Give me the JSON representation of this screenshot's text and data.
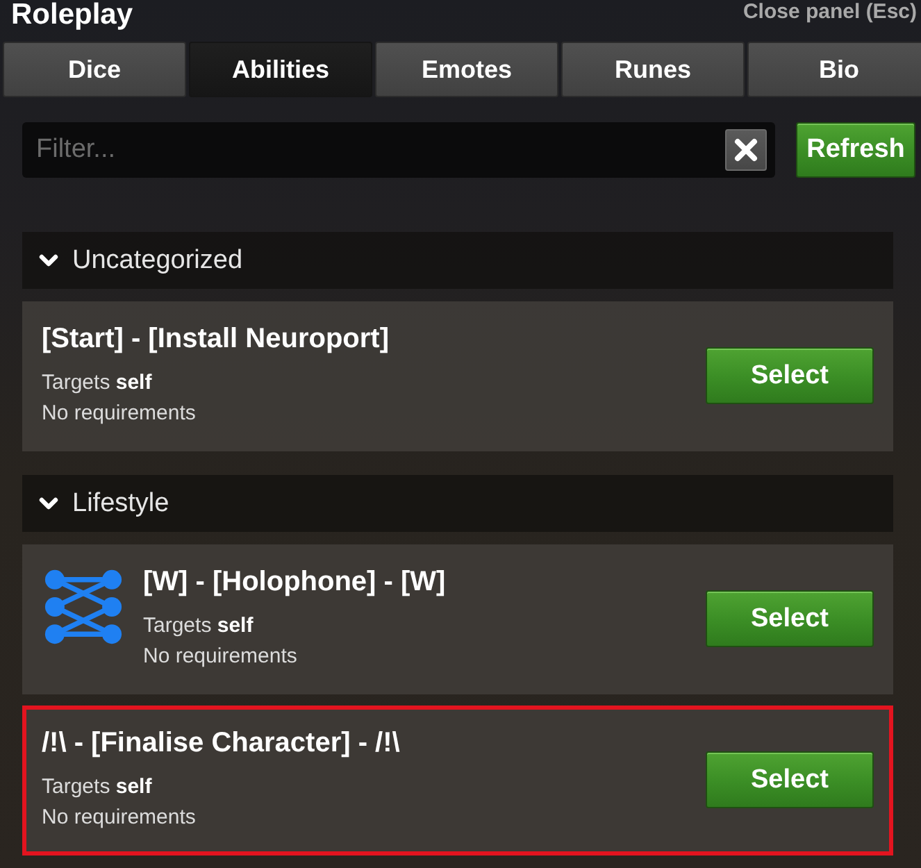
{
  "window": {
    "title": "Roleplay",
    "close_hint": "Close panel (Esc)"
  },
  "tabs": [
    {
      "label": "Dice",
      "selected": false
    },
    {
      "label": "Abilities",
      "selected": true
    },
    {
      "label": "Emotes",
      "selected": false
    },
    {
      "label": "Runes",
      "selected": false
    },
    {
      "label": "Bio",
      "selected": false
    }
  ],
  "filter": {
    "placeholder": "Filter...",
    "refresh_label": "Refresh"
  },
  "categories": [
    {
      "name": "Uncategorized",
      "expanded": true,
      "abilities": [
        {
          "title": "[Start] - [Install Neuroport]",
          "targets": "Targets **self**",
          "requirements": "No requirements",
          "has_icon": false,
          "highlighted": false,
          "button": "Select"
        }
      ]
    },
    {
      "name": "Lifestyle",
      "expanded": true,
      "abilities": [
        {
          "title": "[W] - [Holophone] - [W]",
          "targets": "Targets **self**",
          "requirements": "No requirements",
          "has_icon": true,
          "highlighted": false,
          "button": "Select"
        },
        {
          "title": "/!\\ - [Finalise Character] - /!\\",
          "targets": "Targets **self**",
          "requirements": "No requirements",
          "has_icon": false,
          "highlighted": true,
          "button": "Select"
        }
      ]
    }
  ]
}
